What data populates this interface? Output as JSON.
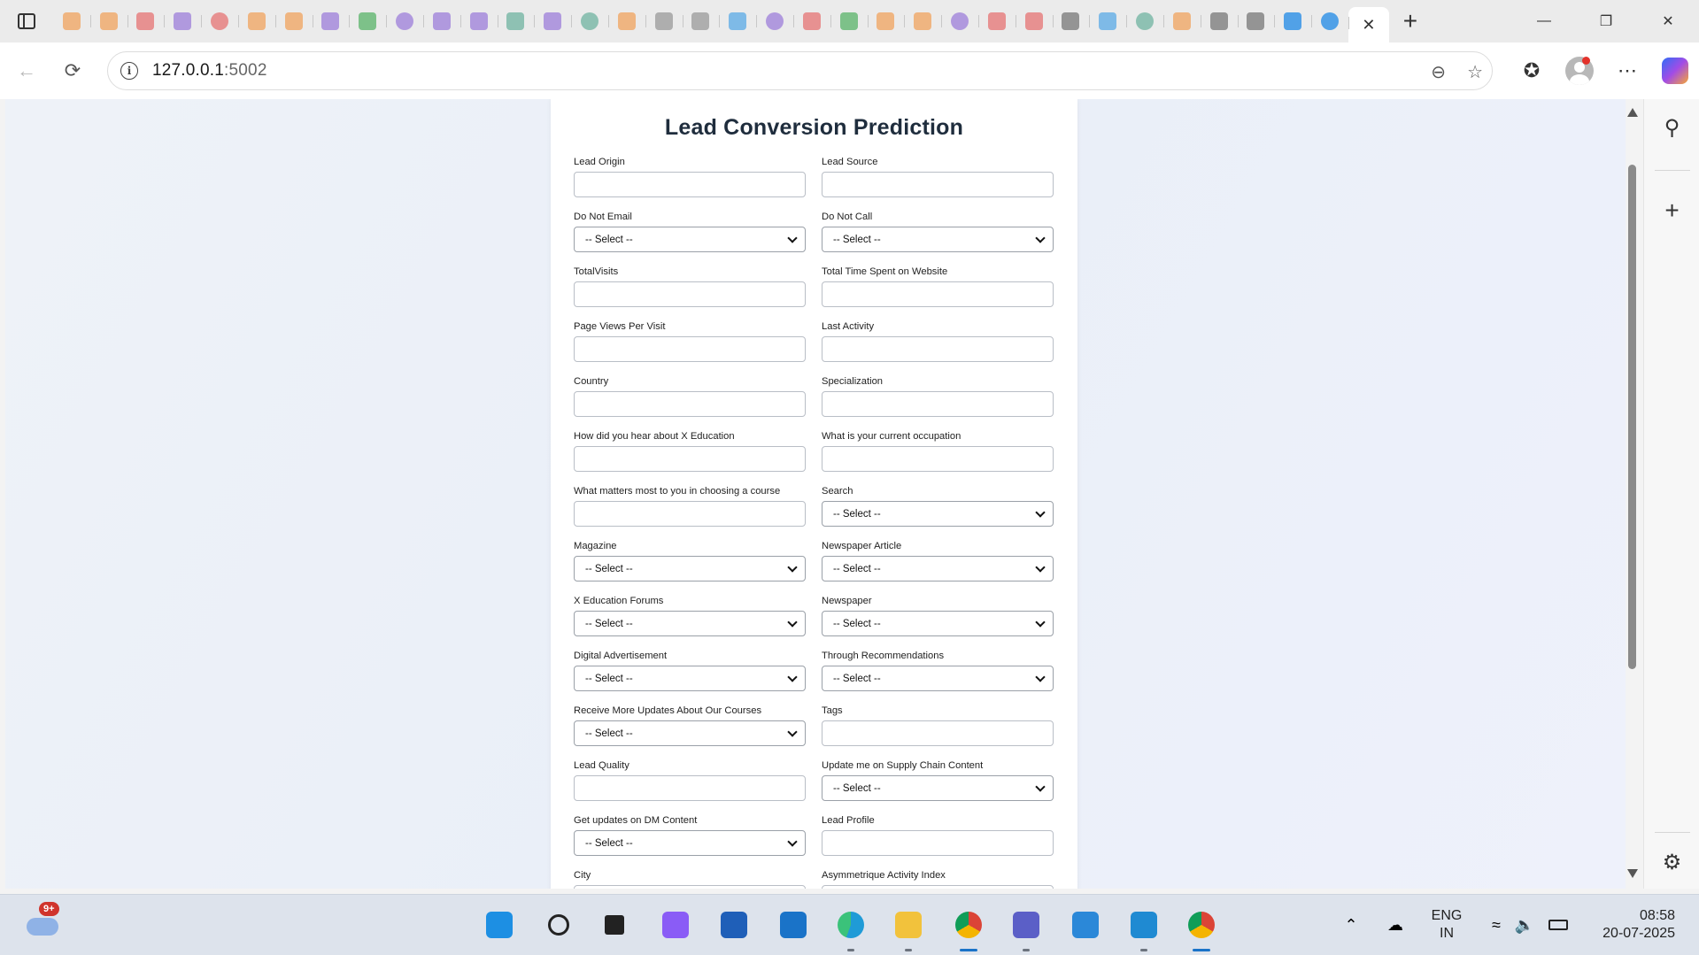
{
  "browser": {
    "url_host": "127.0.0.1",
    "url_port": ":5002",
    "tab_favicon_colors": [
      "#f0a35e",
      "#f0a35e",
      "#e57373",
      "#9c7ed9",
      "#e57373",
      "#f0a35e",
      "#f0a35e",
      "#9c7ed9",
      "#58b368",
      "#9c7ed9",
      "#9c7ed9",
      "#9c7ed9",
      "#6fb3a0",
      "#9c7ed9",
      "#6fb3a0",
      "#f0a35e",
      "#9a9a9a",
      "#9a9a9a",
      "#5aa9e6",
      "#9c7ed9",
      "#e57373",
      "#58b368",
      "#f0a35e",
      "#f0a35e",
      "#9c7ed9",
      "#e57373",
      "#e57373",
      "#777777",
      "#5aa9e6",
      "#6fb3a0",
      "#f0a35e",
      "#777777",
      "#777777",
      "#1e88e5",
      "#1e88e5"
    ],
    "close_tab_icon": "✕",
    "new_tab_icon": "+"
  },
  "page": {
    "title": "Lead Conversion Prediction",
    "fields": [
      {
        "label": "Lead Origin",
        "type": "text",
        "value": ""
      },
      {
        "label": "Lead Source",
        "type": "text",
        "value": ""
      },
      {
        "label": "Do Not Email",
        "type": "select",
        "value": "-- Select --"
      },
      {
        "label": "Do Not Call",
        "type": "select",
        "value": "-- Select --"
      },
      {
        "label": "TotalVisits",
        "type": "text",
        "value": ""
      },
      {
        "label": "Total Time Spent on Website",
        "type": "text",
        "value": ""
      },
      {
        "label": "Page Views Per Visit",
        "type": "text",
        "value": ""
      },
      {
        "label": "Last Activity",
        "type": "text",
        "value": ""
      },
      {
        "label": "Country",
        "type": "text",
        "value": ""
      },
      {
        "label": "Specialization",
        "type": "text",
        "value": ""
      },
      {
        "label": "How did you hear about X Education",
        "type": "text",
        "value": ""
      },
      {
        "label": "What is your current occupation",
        "type": "text",
        "value": ""
      },
      {
        "label": "What matters most to you in choosing a course",
        "type": "text",
        "value": ""
      },
      {
        "label": "Search",
        "type": "select",
        "value": "-- Select --"
      },
      {
        "label": "Magazine",
        "type": "select",
        "value": "-- Select --"
      },
      {
        "label": "Newspaper Article",
        "type": "select",
        "value": "-- Select --"
      },
      {
        "label": "X Education Forums",
        "type": "select",
        "value": "-- Select --"
      },
      {
        "label": "Newspaper",
        "type": "select",
        "value": "-- Select --"
      },
      {
        "label": "Digital Advertisement",
        "type": "select",
        "value": "-- Select --"
      },
      {
        "label": "Through Recommendations",
        "type": "select",
        "value": "-- Select --"
      },
      {
        "label": "Receive More Updates About Our Courses",
        "type": "select",
        "value": "-- Select --"
      },
      {
        "label": "Tags",
        "type": "text",
        "value": ""
      },
      {
        "label": "Lead Quality",
        "type": "text",
        "value": ""
      },
      {
        "label": "Update me on Supply Chain Content",
        "type": "select",
        "value": "-- Select --"
      },
      {
        "label": "Get updates on DM Content",
        "type": "select",
        "value": "-- Select --"
      },
      {
        "label": "Lead Profile",
        "type": "text",
        "value": ""
      },
      {
        "label": "City",
        "type": "text",
        "value": ""
      },
      {
        "label": "Asymmetrique Activity Index",
        "type": "text",
        "value": ""
      }
    ]
  },
  "taskbar": {
    "notification_badge": "9+",
    "language_line1": "ENG",
    "language_line2": "IN",
    "time": "08:58",
    "date": "20-07-2025",
    "apps": [
      {
        "name": "start",
        "color": "#1d8fe3"
      },
      {
        "name": "search",
        "color": "#222222"
      },
      {
        "name": "task-view",
        "color": "#222222"
      },
      {
        "name": "copilot",
        "color": "#8a5cf6"
      },
      {
        "name": "store",
        "color": "#1f5fb8"
      },
      {
        "name": "outlook",
        "color": "#1a73c8"
      },
      {
        "name": "edge",
        "color": "#1f9bd7"
      },
      {
        "name": "file-explorer",
        "color": "#f2c23c"
      },
      {
        "name": "chrome",
        "color": "#db4437"
      },
      {
        "name": "teams",
        "color": "#5b5fc7"
      },
      {
        "name": "notepad",
        "color": "#2b88d8"
      },
      {
        "name": "vscode",
        "color": "#1f8ad2"
      },
      {
        "name": "chrome-profile",
        "color": "#db4437"
      }
    ]
  }
}
